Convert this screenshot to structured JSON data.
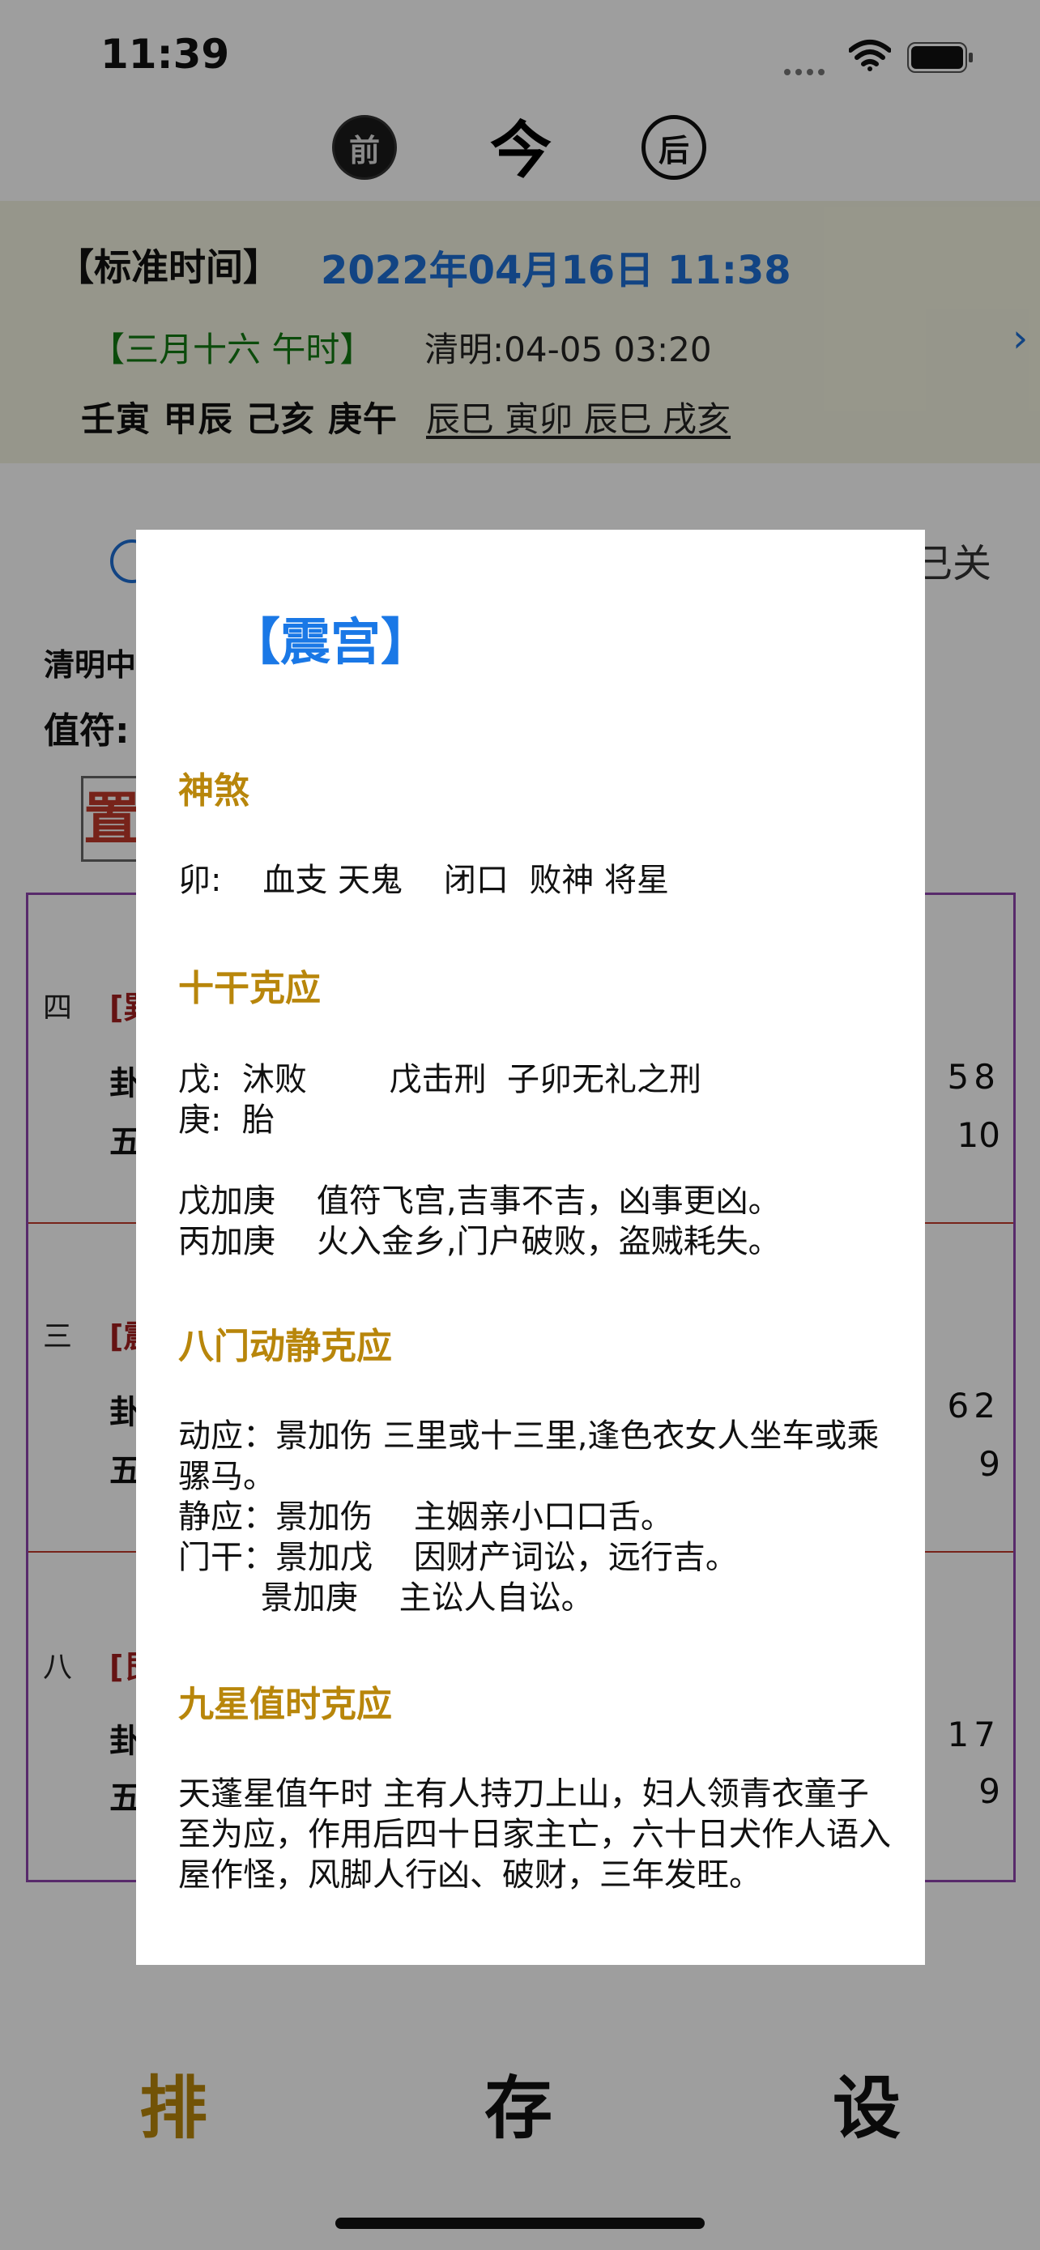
{
  "status_bar": {
    "time": "11:39"
  },
  "nav": {
    "prev_label": "前",
    "today_label": "今",
    "next_label": "后"
  },
  "header": {
    "std_label": "【标准时间】",
    "std_value": "2022年04月16日 11:38",
    "lunar": "【三月十六  午时】",
    "solar_term": "清明:04-05 03:20",
    "ganzhi": "壬寅 甲辰 己亥 庚午",
    "hidden_ganzhi": "辰巳 寅卯 辰巳 戌亥"
  },
  "background": {
    "toggle_label": "已关",
    "qingming": "清明中",
    "zhifu": "值符:",
    "stamp": "置",
    "rows": [
      {
        "num": "四",
        "tag": "[巽",
        "gua": "卦",
        "wu": "五",
        "r1": "58",
        "r2": "10"
      },
      {
        "num": "三",
        "tag": "[震",
        "gua": "卦",
        "wu": "五",
        "r1": "62",
        "r2": "9"
      },
      {
        "num": "八",
        "tag": "[艮",
        "gua": "卦",
        "wu": "五",
        "r1": "17",
        "r2": "9"
      }
    ]
  },
  "tabs": {
    "pai": "排",
    "cun": "存",
    "she": "设"
  },
  "modal": {
    "title": "【震宫】",
    "sections": {
      "shensha": {
        "heading": "神煞",
        "lines": [
          "卯:    血支 天鬼    闭口  败神 将星"
        ]
      },
      "shigan": {
        "heading": "十干克应",
        "lines": [
          "戊:  沐败        戊击刑  子卯无礼之刑",
          "庚:  胎",
          "戊加庚    值符飞宫,吉事不吉，凶事更凶。",
          "丙加庚    火入金乡,门户破败，盗贼耗失。"
        ]
      },
      "bamen": {
        "heading": "八门动静克应",
        "lines": [
          "动应：景加伤    三里或十三里,逢色衣女人坐车或乘骡马。",
          "静应：景加伤    主姻亲小口口舌。",
          "门干：景加戊    因财产词讼，远行吉。",
          "        景加庚    主讼人自讼。"
        ]
      },
      "jiuxing": {
        "heading": "九星值时克应",
        "lines": [
          "天蓬星值午时    主有人持刀上山，妇人领青衣童子至为应，作用后四十日家主亡，六十日犬作人语入屋作怪，风脚人行凶、破财，三年发旺。"
        ]
      }
    }
  }
}
